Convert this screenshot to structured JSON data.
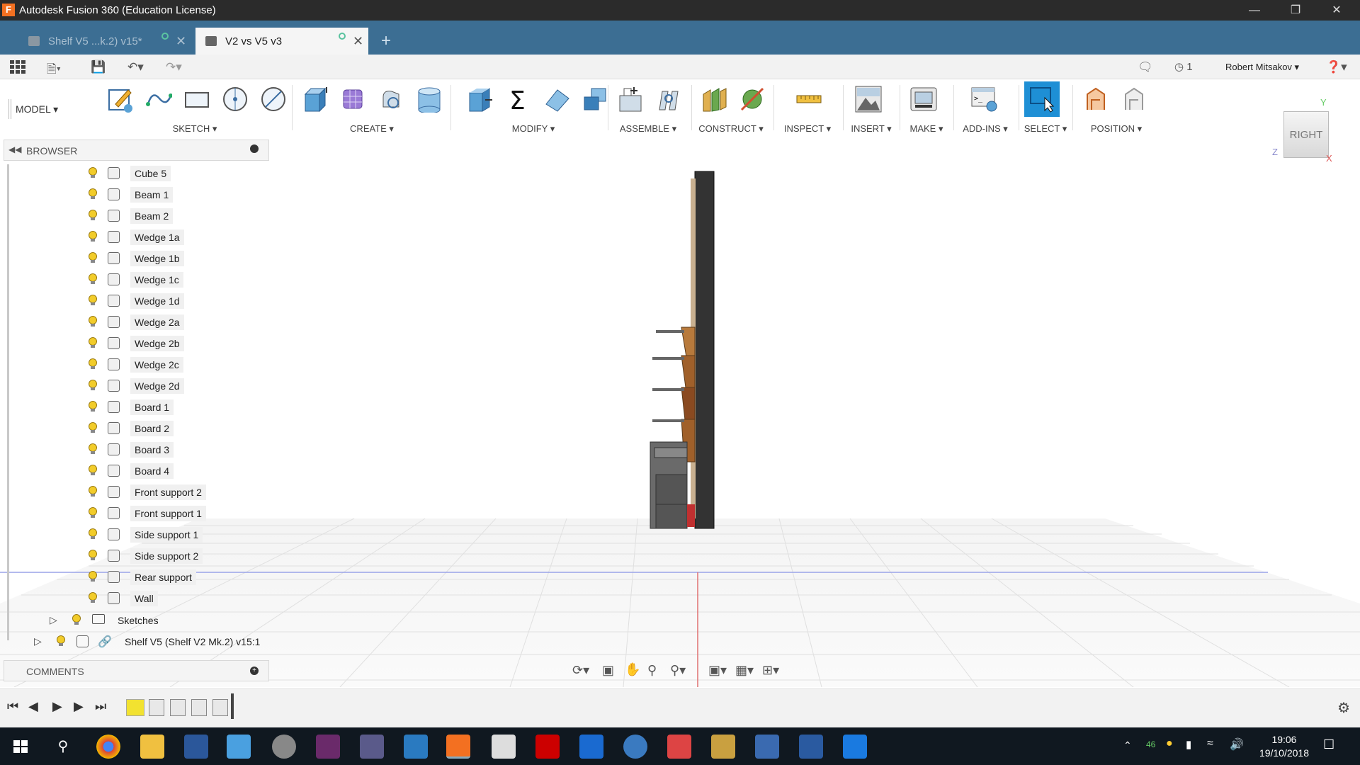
{
  "window": {
    "title": "Autodesk Fusion 360 (Education License)",
    "app_icon": "F"
  },
  "tabs": [
    {
      "label": "Shelf V5 ...k.2) v15*",
      "active": false
    },
    {
      "label": "V2 vs V5 v3",
      "active": true
    }
  ],
  "quickbar": {
    "jobs_count": "1",
    "user": "Robert Mitsakov"
  },
  "workspace": {
    "label": "MODEL"
  },
  "ribbon_groups": [
    {
      "label": "SKETCH",
      "icons": [
        "create-sketch-icon",
        "spline-icon",
        "rectangle-icon",
        "circle-icon",
        "line-icon"
      ]
    },
    {
      "label": "CREATE",
      "icons": [
        "extrude-icon",
        "form-icon",
        "revolve-icon",
        "cylinder-icon"
      ]
    },
    {
      "label": "MODIFY",
      "icons": [
        "press-pull-icon",
        "parameters-icon",
        "fillet-icon",
        "combine-icon"
      ]
    },
    {
      "label": "ASSEMBLE",
      "icons": [
        "new-component-icon",
        "joint-icon"
      ]
    },
    {
      "label": "CONSTRUCT",
      "icons": [
        "offset-plane-icon",
        "axis-icon"
      ]
    },
    {
      "label": "INSPECT",
      "icons": [
        "measure-icon"
      ]
    },
    {
      "label": "INSERT",
      "icons": [
        "insert-image-icon"
      ]
    },
    {
      "label": "MAKE",
      "icons": [
        "print-icon"
      ]
    },
    {
      "label": "ADD-INS",
      "icons": [
        "scripts-icon"
      ]
    },
    {
      "label": "SELECT",
      "icons": [
        "select-icon"
      ]
    },
    {
      "label": "POSITION",
      "icons": [
        "capture-position-icon",
        "revert-icon"
      ]
    }
  ],
  "browser": {
    "title": "BROWSER",
    "items": [
      "Cube 5",
      "Beam 1",
      "Beam 2",
      "Wedge 1a",
      "Wedge 1b",
      "Wedge 1c",
      "Wedge 1d",
      "Wedge 2a",
      "Wedge 2b",
      "Wedge 2c",
      "Wedge 2d",
      "Board 1",
      "Board 2",
      "Board 3",
      "Board 4",
      "Front support 2",
      "Front support 1",
      "Side support 1",
      "Side support 2",
      "Rear support",
      "Wall"
    ],
    "sketches_label": "Sketches",
    "linked_component": "Shelf V5 (Shelf V2 Mk.2) v15:1"
  },
  "comments": {
    "title": "COMMENTS"
  },
  "viewcube": {
    "face": "RIGHT",
    "axes": [
      "Y",
      "Z",
      "X"
    ]
  },
  "clock": {
    "time": "19:06",
    "date": "19/10/2018"
  },
  "tray": {
    "badge": "46"
  },
  "colors": {
    "tab_bar": "#3c6e93",
    "title_bar": "#2b2b2b",
    "select_active": "#1e8fd5",
    "taskbar": "#101820"
  }
}
